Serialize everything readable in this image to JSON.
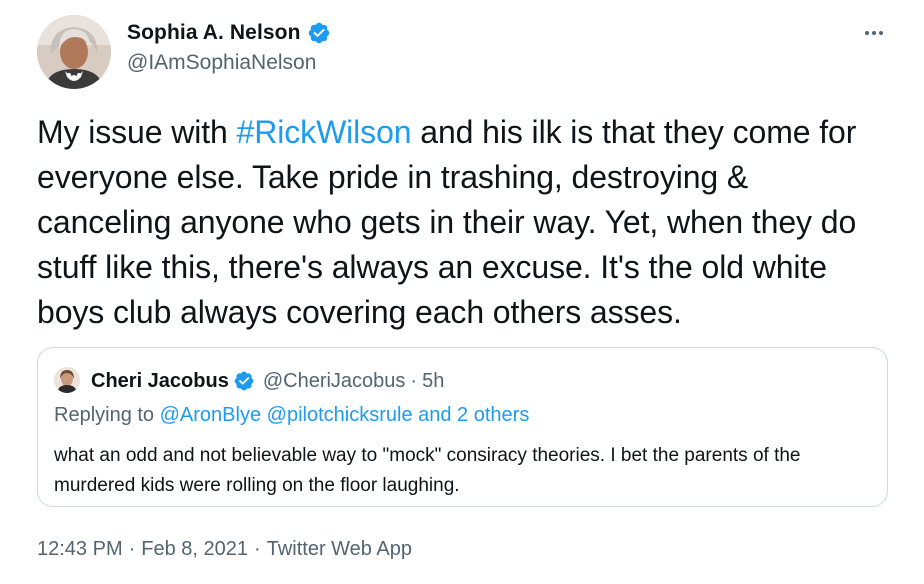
{
  "author": {
    "name": "Sophia A. Nelson",
    "handle": "@IAmSophiaNelson",
    "verified": true,
    "avatar_icon": "avatar-photo-woman"
  },
  "tweet": {
    "text_before_hashtag": "My issue with ",
    "hashtag": "#RickWilson",
    "text_after_hashtag": " and his ilk is that they come for everyone else. Take pride in trashing, destroying & canceling anyone who gets in their way. Yet, when they do stuff like this, there's always an excuse. It's the old white boys club always covering each others asses."
  },
  "quoted": {
    "name": "Cheri Jacobus",
    "handle": "@CheriJacobus",
    "separator": "·",
    "time": "5h",
    "verified": true,
    "replying_prefix": "Replying to ",
    "mention_1": "@AronBlye",
    "mention_2": "@pilotchicksrule",
    "replying_suffix": " and 2 others",
    "text": "what an odd and not believable way to \"mock\" consiracy theories.  I bet the parents of the murdered kids were rolling on the floor laughing."
  },
  "meta": {
    "time": "12:43 PM",
    "separator_1": "·",
    "date": "Feb 8, 2021",
    "separator_2": "·",
    "source": "Twitter Web App"
  },
  "colors": {
    "link": "#1d9bf0",
    "secondary_text": "#536471",
    "primary_text": "#0f1419",
    "border": "#cfd9de"
  },
  "icons": {
    "verified": "verified-badge-icon",
    "more": "more-options-icon"
  }
}
